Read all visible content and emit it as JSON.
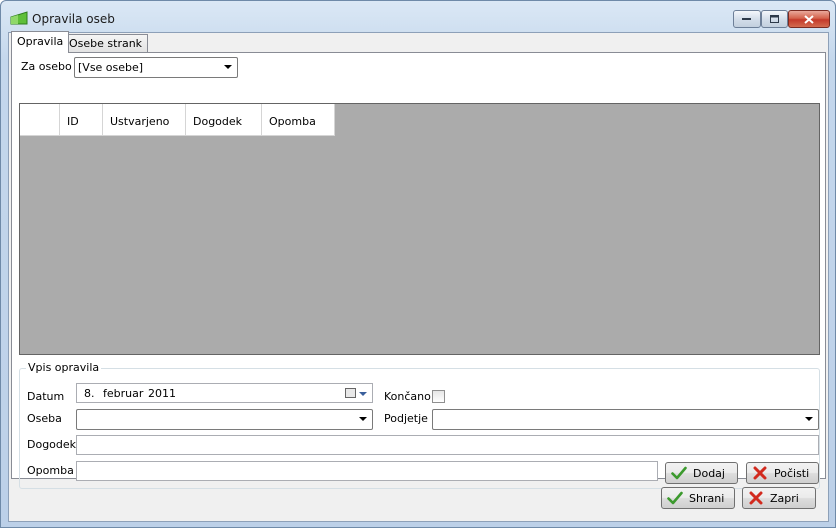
{
  "window": {
    "title": "Opravila oseb"
  },
  "tabs": [
    {
      "label": "Opravila"
    },
    {
      "label": "Osebe strank"
    }
  ],
  "filter": {
    "label": "Za osebo",
    "selected": "[Vse osebe]"
  },
  "grid": {
    "columns": [
      "ID",
      "Ustvarjeno",
      "Dogodek",
      "Opomba"
    ],
    "rows": []
  },
  "entry": {
    "group_title": "Vpis opravila",
    "date_label": "Datum",
    "date_day": "8.",
    "date_month": "februar",
    "date_year": "2011",
    "done_label": "Končano",
    "done_checked": false,
    "person_label": "Oseba",
    "person_value": "",
    "company_label": "Podjetje",
    "company_value": "",
    "event_label": "Dogodek",
    "event_value": "",
    "note_label": "Opomba",
    "note_value": "",
    "add_label": "Dodaj",
    "clear_label": "Počisti"
  },
  "footer": {
    "save_label": "Shrani",
    "close_label": "Zapri"
  },
  "colors": {
    "grid_background": "#ababab",
    "check_green": "#3c9a2e",
    "cross_red": "#d22a1e"
  }
}
